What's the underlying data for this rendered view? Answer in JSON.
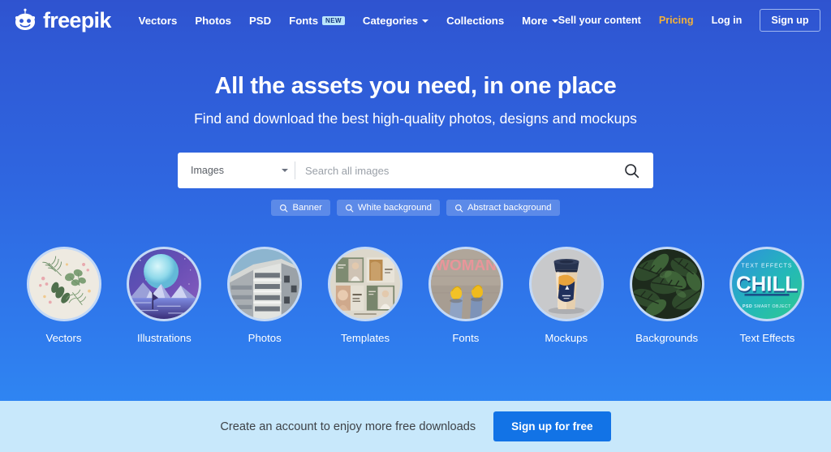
{
  "header": {
    "logo_text": "freepik",
    "nav": [
      {
        "label": "Vectors",
        "badge": null,
        "caret": false
      },
      {
        "label": "Photos",
        "badge": null,
        "caret": false
      },
      {
        "label": "PSD",
        "badge": null,
        "caret": false
      },
      {
        "label": "Fonts",
        "badge": "NEW",
        "caret": false
      },
      {
        "label": "Categories",
        "badge": null,
        "caret": true
      },
      {
        "label": "Collections",
        "badge": null,
        "caret": false
      },
      {
        "label": "More",
        "badge": null,
        "caret": true
      }
    ],
    "sell_label": "Sell your content",
    "pricing_label": "Pricing",
    "login_label": "Log in",
    "signup_label": "Sign up",
    "pricing_color": "#f2b13b"
  },
  "hero": {
    "title": "All the assets you need, in one place",
    "subtitle": "Find and download the best high-quality photos, designs and mockups"
  },
  "search": {
    "selected_type": "Images",
    "placeholder": "Search all images",
    "value": "",
    "search_icon": "search-icon",
    "chips": [
      {
        "label": "Banner"
      },
      {
        "label": "White background"
      },
      {
        "label": "Abstract background"
      }
    ]
  },
  "categories": [
    {
      "label": "Vectors",
      "thumb": "botanical-leaves"
    },
    {
      "label": "Illustrations",
      "thumb": "moon-mountains"
    },
    {
      "label": "Photos",
      "thumb": "architecture-building"
    },
    {
      "label": "Templates",
      "thumb": "fashion-template-grid"
    },
    {
      "label": "Fonts",
      "thumb": "woman-chalk-shoes"
    },
    {
      "label": "Mockups",
      "thumb": "coffee-cup"
    },
    {
      "label": "Backgrounds",
      "thumb": "monstera-leaves"
    },
    {
      "label": "Text Effects",
      "thumb": "chill-text-effect"
    }
  ],
  "text_effect_thumb": {
    "top_label": "TEXT EFFECTS",
    "main_word": "CHILL",
    "bottom_label_bold": "PSD",
    "bottom_label": "SMART OBJECT"
  },
  "fonts_thumb": {
    "word": "WOMAN"
  },
  "bottom_banner": {
    "text": "Create an account to enjoy more free downloads",
    "button_label": "Sign up for free",
    "background": "#c8e8fb",
    "button_color": "#1273e6"
  }
}
